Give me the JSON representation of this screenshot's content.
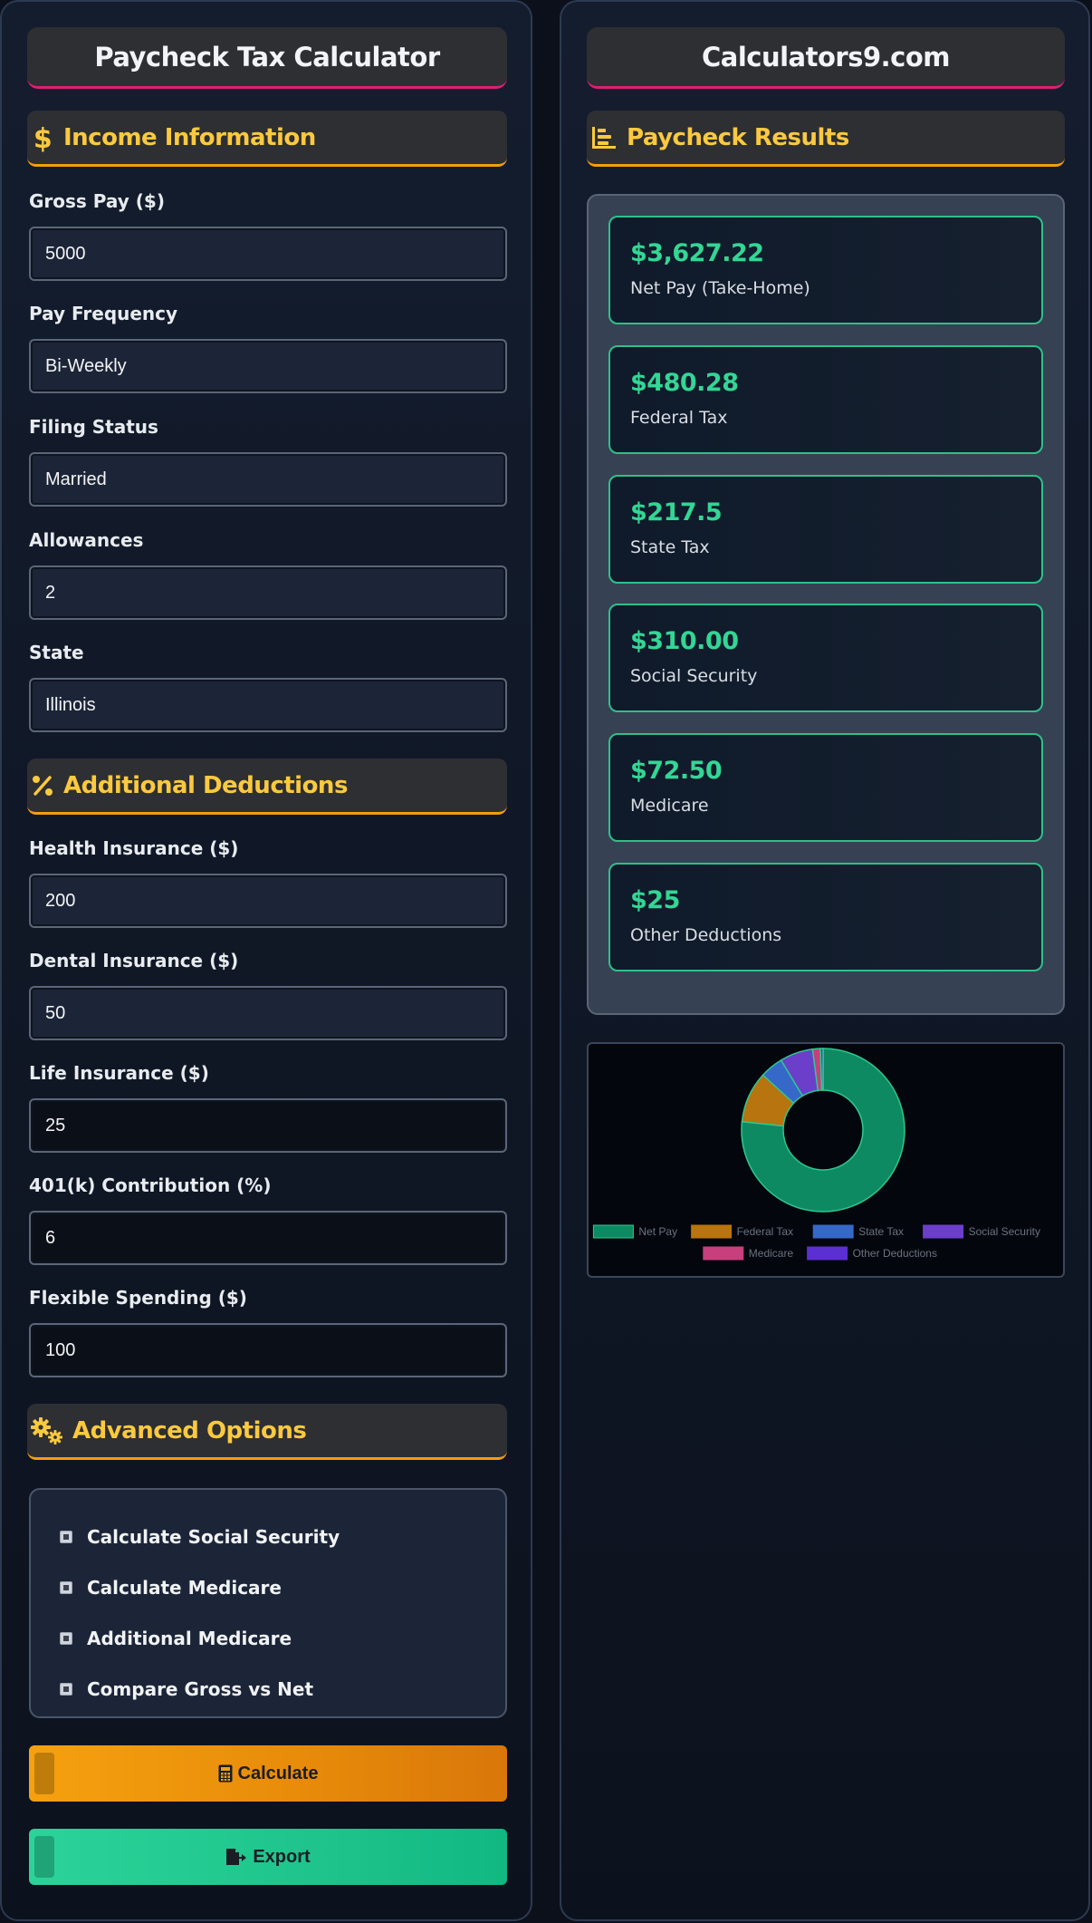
{
  "left_title": "Paycheck Tax Calculator",
  "right_title": "Calculators9.com",
  "sections": {
    "income": "Income Information",
    "deductions": "Additional Deductions",
    "advanced": "Advanced Options",
    "results": "Paycheck Results"
  },
  "income": {
    "gross_pay_label": "Gross Pay ($)",
    "gross_pay_value": "5000",
    "pay_frequency_label": "Pay Frequency",
    "pay_frequency_value": "Bi-Weekly",
    "filing_status_label": "Filing Status",
    "filing_status_value": "Married",
    "allowances_label": "Allowances",
    "allowances_value": "2",
    "state_label": "State",
    "state_value": "Illinois"
  },
  "deductions": {
    "health_label": "Health Insurance ($)",
    "health_value": "200",
    "dental_label": "Dental Insurance ($)",
    "dental_value": "50",
    "life_label": "Life Insurance ($)",
    "life_value": "25",
    "k401_label": "401(k) Contribution (%)",
    "k401_value": "6",
    "fsa_label": "Flexible Spending ($)",
    "fsa_value": "100"
  },
  "options": [
    "Calculate Social Security",
    "Calculate Medicare",
    "Additional Medicare",
    "Compare Gross vs Net"
  ],
  "buttons": {
    "calculate": "Calculate",
    "export": "Export"
  },
  "results": [
    {
      "value": "$3,627.22",
      "label": "Net Pay (Take-Home)"
    },
    {
      "value": "$480.28",
      "label": "Federal Tax"
    },
    {
      "value": "$217.5",
      "label": "State Tax"
    },
    {
      "value": "$310.00",
      "label": "Social Security"
    },
    {
      "value": "$72.50",
      "label": "Medicare"
    },
    {
      "value": "$25",
      "label": "Other Deductions"
    }
  ],
  "colors": {
    "accent_pink": "#e11d74",
    "accent_amber": "#f59e0b",
    "heading_yellow": "#fbc93f",
    "result_green": "#33d695"
  },
  "chart_data": {
    "type": "pie",
    "categories": [
      "Net Pay",
      "Federal Tax",
      "State Tax",
      "Social Security",
      "Medicare",
      "Other Deductions"
    ],
    "values": [
      3627.22,
      480.28,
      217.5,
      310.0,
      72.5,
      25
    ],
    "colors": [
      "#0e8a62",
      "#b8740e",
      "#3668c9",
      "#6b3fc9",
      "#c73f7c",
      "#5b2fd1"
    ],
    "donut": true,
    "legend": "bottom"
  }
}
